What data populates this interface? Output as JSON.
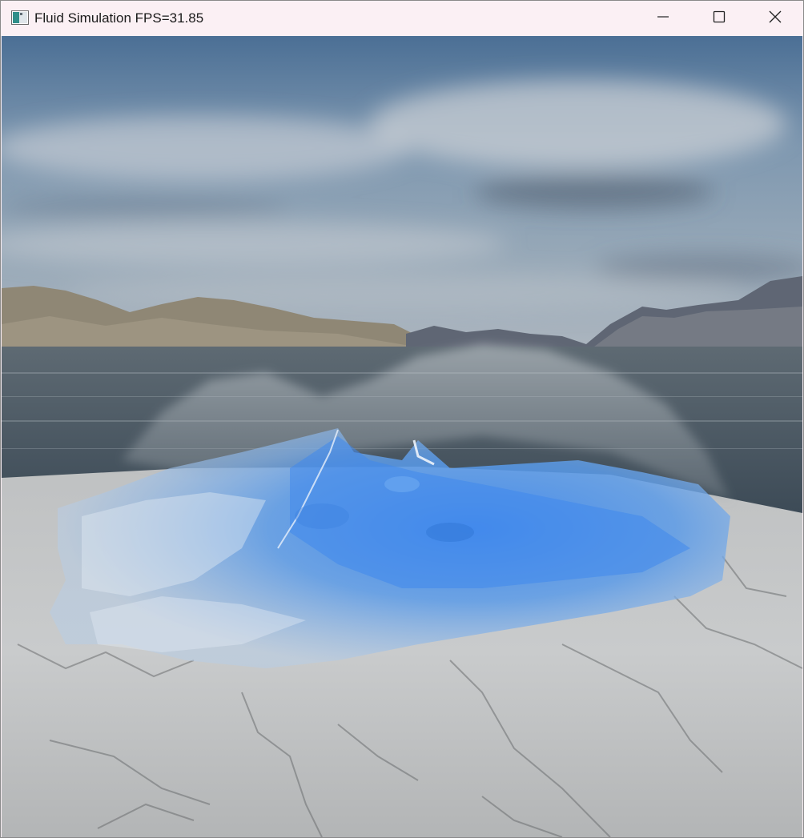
{
  "window": {
    "title": "Fluid Simulation FPS=31.85",
    "icon": "app-window-icon",
    "controls": {
      "minimize_icon": "minimize-icon",
      "maximize_icon": "maximize-icon",
      "close_icon": "close-icon"
    }
  },
  "scene": {
    "colors": {
      "sky_top": "#4a6f96",
      "sky_mid": "#8ea3b6",
      "sky_horizon": "#a9b4bf",
      "water": "#4b5a66",
      "fluid": "#4a8fe8",
      "fluid_light": "#a9c8f0",
      "stone": "#c9cbcc",
      "mountain": "#8d8573"
    }
  }
}
